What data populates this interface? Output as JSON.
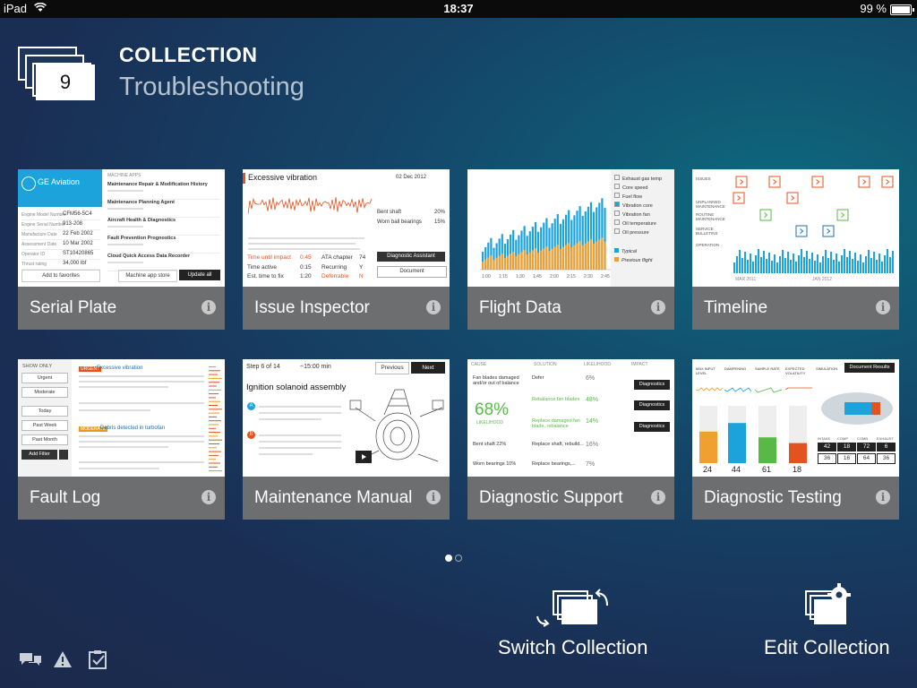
{
  "status_bar": {
    "carrier": "iPad",
    "time": "18:37",
    "battery": "99 %",
    "battery_level": 0.99
  },
  "header": {
    "count": "9",
    "label": "COLLECTION",
    "name": "Troubleshooting"
  },
  "tiles": [
    {
      "title": "Serial Plate",
      "icon": "info-icon"
    },
    {
      "title": "Issue Inspector",
      "icon": "info-icon"
    },
    {
      "title": "Flight Data",
      "icon": "info-icon"
    },
    {
      "title": "Timeline",
      "icon": "info-icon"
    },
    {
      "title": "Fault Log",
      "icon": "info-icon"
    },
    {
      "title": "Maintenance Manual",
      "icon": "info-icon"
    },
    {
      "title": "Diagnostic Support",
      "icon": "info-icon"
    },
    {
      "title": "Diagnostic Testing",
      "icon": "info-icon"
    }
  ],
  "thumbs": {
    "serial_plate": {
      "brand": "GE Aviation",
      "section": "MACHINE APPS",
      "rows": [
        {
          "label": "Engine Model Number",
          "value": "CFM56-5C4"
        },
        {
          "label": "Engine Serial Number",
          "value": "913-208"
        },
        {
          "label": "Manufacture Date",
          "value": "22 Feb 2002"
        },
        {
          "label": "Assessment Date",
          "value": "10 Mar 2002"
        },
        {
          "label": "Operator ID",
          "value": "ST10420865"
        },
        {
          "label": "Thrust rating",
          "value": "34,000 lbf"
        }
      ],
      "apps": [
        "Maintenance Repair & Modification History",
        "Maintenance Planning Agent",
        "Aircraft Health & Diagnostics",
        "Fault Prevention Prognostics",
        "Cloud Quick Access Data Recorder"
      ],
      "add_favorites": "Add to favorites",
      "app_store": "Machine app store",
      "update_all": "Update all"
    },
    "issue_inspector": {
      "title": "Excessive vibration",
      "date": "02 Dec 2012",
      "time_until_impact_label": "Time until impact",
      "time_until_impact": "0:45",
      "time_active_label": "Time active",
      "time_active": "0:15",
      "est_time_label": "Est. time to fix",
      "est_time": "1:20",
      "ata_label": "ATA chapter",
      "ata": "74",
      "recurring_label": "Recurring",
      "recurring": "Y",
      "deferrable_label": "Deferrable",
      "deferrable": "N",
      "cause1": "Bent shaft",
      "cause1_pct": "20%",
      "cause2": "Worn ball bearings",
      "cause2_pct": "15%",
      "btn_assistant": "Diagnostic Assistant",
      "btn_document": "Document"
    },
    "flight_data": {
      "indicators": [
        "Exhaust gas temp",
        "Core speed",
        "Fuel flow",
        "Vibration core",
        "Vibration fan",
        "Oil temperature",
        "Oil pressure"
      ],
      "compared": [
        "Typical",
        "Previous flight"
      ],
      "x_labels": [
        "1:00",
        "1:15",
        "1:30",
        "1:45",
        "2:00",
        "2:15",
        "2:30",
        "2:45"
      ]
    },
    "timeline": {
      "rows": [
        "ISSUES",
        "UNPLANNED MAINTENANCE",
        "ROUTINE MAINTENANCE",
        "SERVICE BULLETINS",
        "OPERATION"
      ],
      "x_labels": [
        "MAR 2011",
        "JAN 2012"
      ]
    },
    "fault_log": {
      "show_only": "SHOW ONLY",
      "filters": [
        "Urgent",
        "Moderate",
        "Today",
        "Past Week",
        "Past Month"
      ],
      "add_filter": "Add Filter",
      "entry1_tag": "URGENT",
      "entry1_title": "Excessive vibration",
      "entry2_tag": "MODERATE",
      "entry2_title": "Debris detected in turbofan"
    },
    "maintenance_manual": {
      "step": "Step 6 of 14",
      "duration": "~15:00 min",
      "prev": "Previous",
      "next": "Next",
      "title": "Ignition solanoid assembly",
      "a_label": "A",
      "b_label": "B"
    },
    "diagnostic_support": {
      "headers": [
        "CAUSE",
        "SOLUTION",
        "LIKELIHOOD",
        "IMPACT"
      ],
      "big_pct": "68%",
      "big_label": "LIKELIHOOD",
      "rows": [
        {
          "cause": "Fan blades damaged and/or out of balance",
          "solution": "Defer",
          "pct": "6%"
        },
        {
          "cause": "",
          "solution": "Rebalance fan blades",
          "pct": "48%"
        },
        {
          "cause": "",
          "solution": "Replace damaged fan blade, rebalance",
          "pct": "14%"
        },
        {
          "cause": "Bent shaft 22%",
          "solution": "Replace shaft, rebuild...",
          "pct": "16%"
        },
        {
          "cause": "Worn bearings 10%",
          "solution": "Replace bearings,...",
          "pct": "7%"
        }
      ],
      "btn": "Diagnostics"
    },
    "diagnostic_testing": {
      "doc_btn": "Document Results",
      "cols": [
        "MAX INPUT LEVEL",
        "DAMPENING",
        "SAMPLE RATE",
        "EXPECTED VOLATILITY",
        "SIMULATION"
      ],
      "values": [
        "24",
        "44",
        "61",
        "18"
      ],
      "readouts": [
        {
          "label": "INTAKE",
          "value": "42",
          "sub": "36"
        },
        {
          "label": "COMP",
          "value": "18",
          "sub": "16"
        },
        {
          "label": "COMB",
          "value": "72",
          "sub": "64"
        },
        {
          "label": "EXHAUST",
          "value": "6",
          "sub": "36"
        }
      ]
    }
  },
  "pagination": {
    "current": 1,
    "total": 2
  },
  "actions": {
    "switch": "Switch Collection",
    "edit": "Edit Collection"
  },
  "bottom_icons": [
    "chat-icon",
    "warning-icon",
    "checklist-icon"
  ]
}
